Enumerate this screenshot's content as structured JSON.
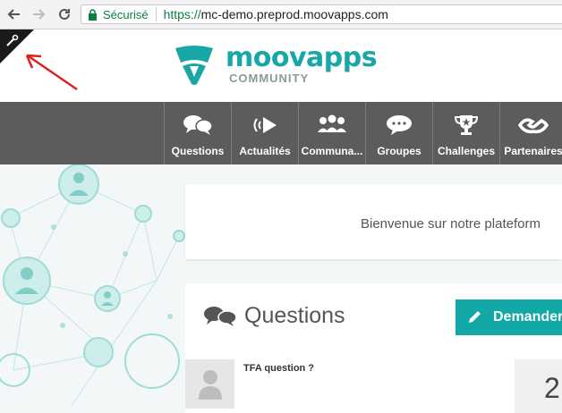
{
  "browser": {
    "secure_label": "Sécurisé",
    "url_scheme": "https://",
    "url_rest": "mc-demo.preprod.moovapps.com"
  },
  "logo": {
    "main": "moovapps",
    "sub": "COMMUNITY"
  },
  "nav": {
    "items": [
      {
        "label": "Questions",
        "icon": "chat-bubbles-icon"
      },
      {
        "label": "Actualités",
        "icon": "broadcast-icon"
      },
      {
        "label": "Communa...",
        "icon": "people-icon"
      },
      {
        "label": "Groupes",
        "icon": "speech-bubble-icon"
      },
      {
        "label": "Challenges",
        "icon": "trophy-icon"
      },
      {
        "label": "Partenaires",
        "icon": "handshake-icon"
      }
    ]
  },
  "welcome": {
    "text": "Bienvenue sur notre plateform"
  },
  "questions": {
    "title": "Questions",
    "ask_button": "Demander",
    "first_item_title": "TFA question ?",
    "first_item_count": "2"
  },
  "colors": {
    "accent": "#12a8a6",
    "navbar": "#5c5c5c",
    "secure_green": "#0b8043",
    "annotation_red": "#e02020"
  }
}
